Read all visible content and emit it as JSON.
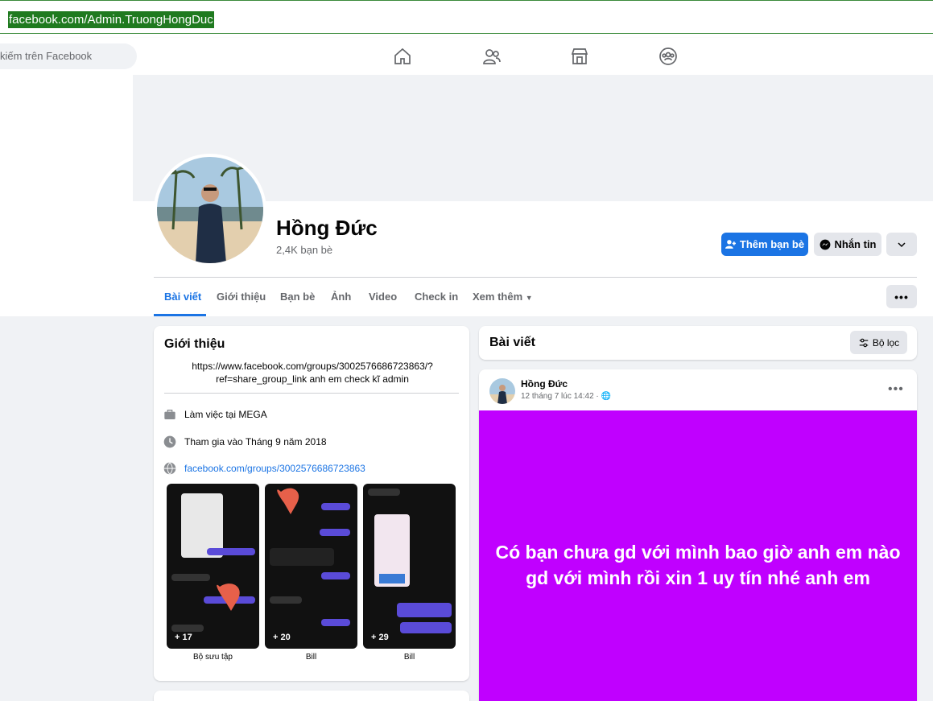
{
  "browser": {
    "url": "facebook.com/Admin.TruongHongDuc"
  },
  "topnav": {
    "search_placeholder": "kiếm trên Facebook"
  },
  "profile": {
    "name": "Hồng Đức",
    "friends_count": "2,4K bạn bè",
    "add_friend_label": "Thêm bạn bè",
    "message_label": "Nhắn tin"
  },
  "tabs": [
    "Bài viết",
    "Giới thiệu",
    "Bạn bè",
    "Ảnh",
    "Video",
    "Check in",
    "Xem thêm"
  ],
  "intro": {
    "title": "Giới thiệu",
    "bio_line1": "https://www.facebook.com/groups/3002576686723863/?",
    "bio_line2": "ref=share_group_link anh em check kĩ admin",
    "work": "Làm việc tại MEGA",
    "joined": "Tham gia vào Tháng 9 năm 2018",
    "website": "facebook.com/groups/3002576686723863",
    "featured": [
      {
        "count": "+ 17",
        "label": "Bộ sưu tập"
      },
      {
        "count": "+ 20",
        "label": "Bill"
      },
      {
        "count": "+ 29",
        "label": "Bill"
      }
    ]
  },
  "posts_header": {
    "title": "Bài viết",
    "filter_label": "Bộ lọc"
  },
  "post": {
    "author": "Hồng Đức",
    "time": "12 tháng 7 lúc 14:42 ·",
    "text": "Có bạn chưa gd với mình bao giờ anh em nào gd với mình rồi xin 1 uy tín nhé anh em",
    "bg_color": "#c000ff"
  },
  "colors": {
    "accent": "#1b74e4"
  }
}
